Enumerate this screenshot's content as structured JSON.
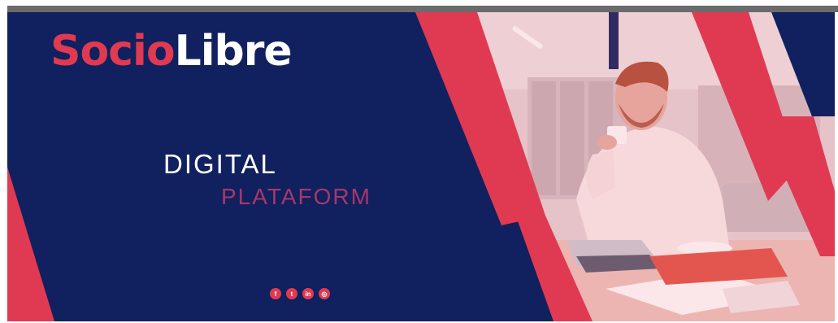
{
  "brand": {
    "name_part1": "Socio",
    "name_part2": "Libre",
    "colors": {
      "navy": "#11205e",
      "accent": "#e03a52",
      "subtitle": "#a6386a"
    }
  },
  "tagline": {
    "line1": "DIGITAL",
    "line2": "PLATAFORM"
  },
  "social": [
    {
      "icon": "facebook-icon",
      "glyph": "f"
    },
    {
      "icon": "twitter-icon",
      "glyph": "t"
    },
    {
      "icon": "linkedin-icon",
      "glyph": "in"
    },
    {
      "icon": "instagram-icon",
      "glyph": "◎"
    }
  ],
  "photo": {
    "subject": "man-drinking-coffee-at-laptop-icon"
  }
}
